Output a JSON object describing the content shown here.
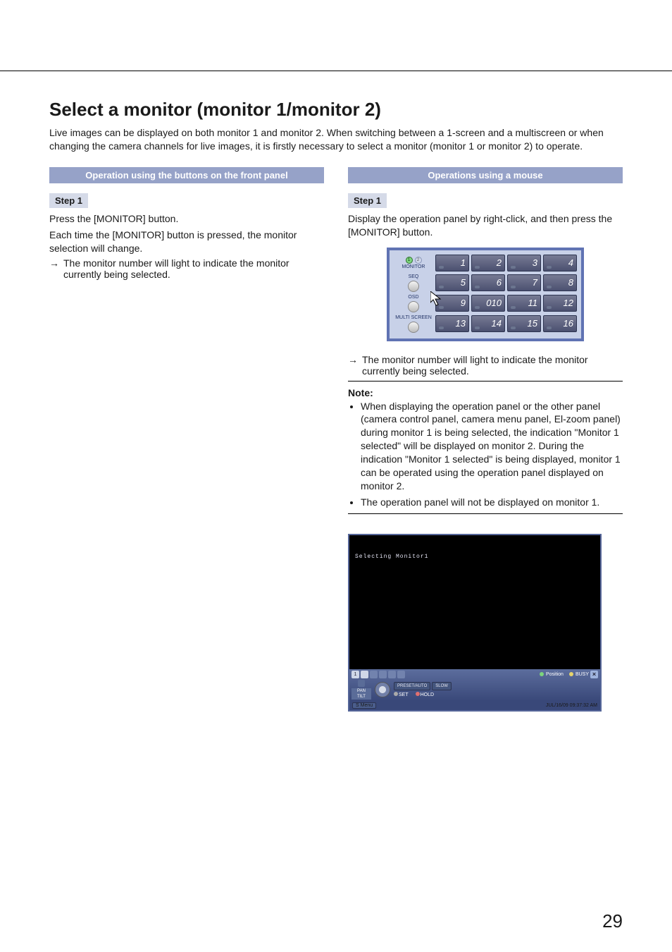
{
  "title": "Select a monitor (monitor 1/monitor 2)",
  "intro": "Live images can be displayed on both monitor 1 and monitor 2. When switching between a 1-screen and a multiscreen or when changing the camera channels for live images, it is firstly necessary to select a monitor (monitor 1 or monitor 2) to operate.",
  "left": {
    "bar": "Operation using the buttons on the front panel",
    "step_label": "Step 1",
    "p1": "Press the [MONITOR] button.",
    "p2": "Each time the [MONITOR] button is pressed, the monitor selection will change.",
    "arrow": "The monitor number will light to indicate the monitor currently being selected."
  },
  "right": {
    "bar": "Operations using a mouse",
    "step_label": "Step 1",
    "p1": "Display the operation panel by right-click, and then press the [MONITOR] button.",
    "arrow": "The monitor number will light to indicate the monitor currently being selected.",
    "note_head": "Note:",
    "notes": [
      "When displaying the operation panel or the other panel (camera control panel, camera menu panel, El-zoom panel) during monitor 1 is being selected, the indication \"Monitor 1 selected\" will be displayed on monitor 2. During the indication \"Monitor 1 selected\" is being displayed, monitor 1 can be operated using the operation panel displayed on monitor 2.",
      "The operation panel will not be displayed on monitor 1."
    ]
  },
  "fig1": {
    "leds": [
      "1",
      "2"
    ],
    "monitor_label": "MONITOR",
    "seq_label": "SEQ",
    "osd_label": "OSD",
    "ms_label": "MULTI SCREEN",
    "rows": [
      [
        "1",
        "2",
        "3",
        "4"
      ],
      [
        "5",
        "6",
        "7",
        "8"
      ],
      [
        "9",
        "010",
        "11",
        "12"
      ],
      [
        "13",
        "14",
        "15",
        "16"
      ]
    ]
  },
  "fig2": {
    "selecting": "Selecting Monitor1",
    "num": "1",
    "position": "Position",
    "busy": "BUSY",
    "preset": "PRESET/AUTO",
    "slow": "SLOW",
    "set": "SET",
    "hold": "HOLD",
    "pan": "PAN",
    "tilt": "TILT",
    "smenu": "S Menu",
    "timestamp": "JUL/16/09 09:37:32 AM"
  },
  "page_number": "29"
}
